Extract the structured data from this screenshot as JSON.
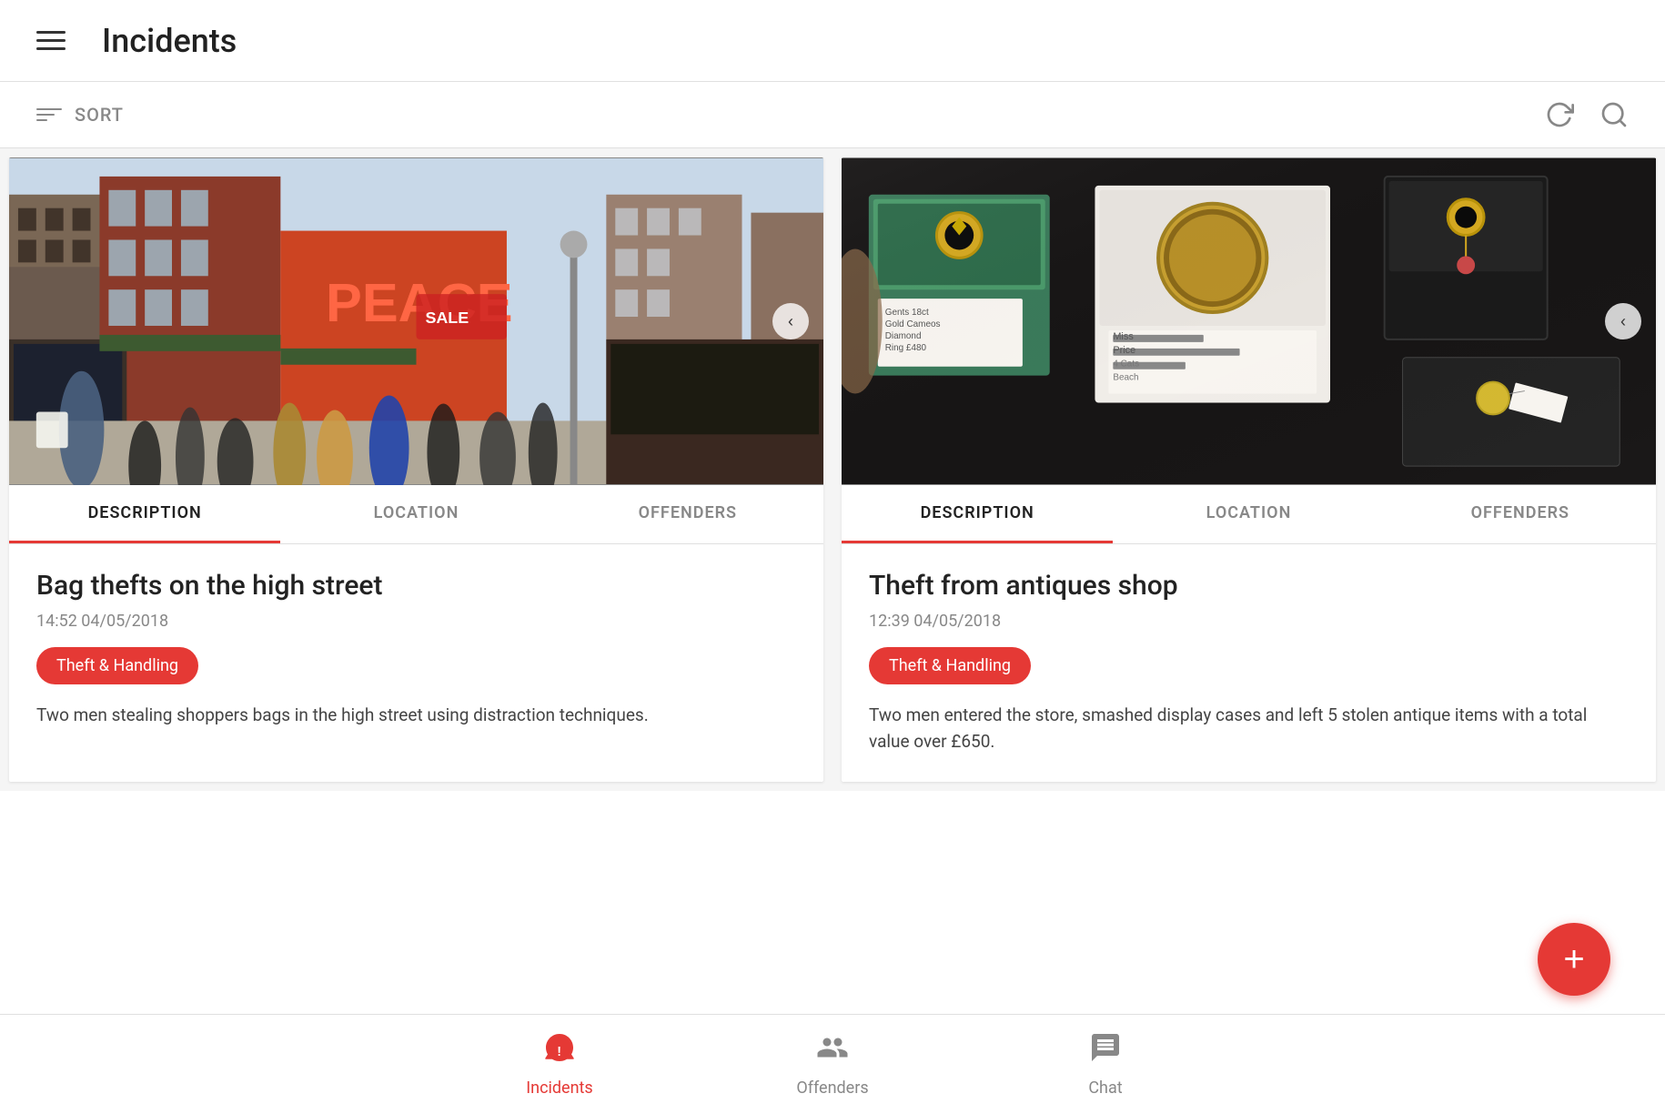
{
  "header": {
    "title": "Incidents",
    "hamburger_label": "Menu"
  },
  "toolbar": {
    "sort_label": "SORT",
    "refresh_label": "Refresh",
    "search_label": "Search"
  },
  "incidents": [
    {
      "id": 1,
      "title": "Bag thefts on the high street",
      "datetime": "14:52  04/05/2018",
      "badge": "Theft & Handling",
      "description": "Two men stealing shoppers bags in the high street using distraction techniques.",
      "tabs": [
        "DESCRIPTION",
        "LOCATION",
        "OFFENDERS"
      ],
      "active_tab": 0,
      "image_type": "street"
    },
    {
      "id": 2,
      "title": "Theft from antiques shop",
      "datetime": "12:39  04/05/2018",
      "badge": "Theft & Handling",
      "description": "Two men entered the store, smashed display cases and left 5 stolen antique items with a total value over £650.",
      "tabs": [
        "DESCRIPTION",
        "LOCATION",
        "OFFENDERS"
      ],
      "active_tab": 0,
      "image_type": "jewelry"
    }
  ],
  "bottom_nav": {
    "items": [
      {
        "id": "incidents",
        "label": "Incidents",
        "active": true
      },
      {
        "id": "offenders",
        "label": "Offenders",
        "active": false
      },
      {
        "id": "chat",
        "label": "Chat",
        "active": false
      }
    ]
  },
  "fab": {
    "label": "Add new incident"
  }
}
